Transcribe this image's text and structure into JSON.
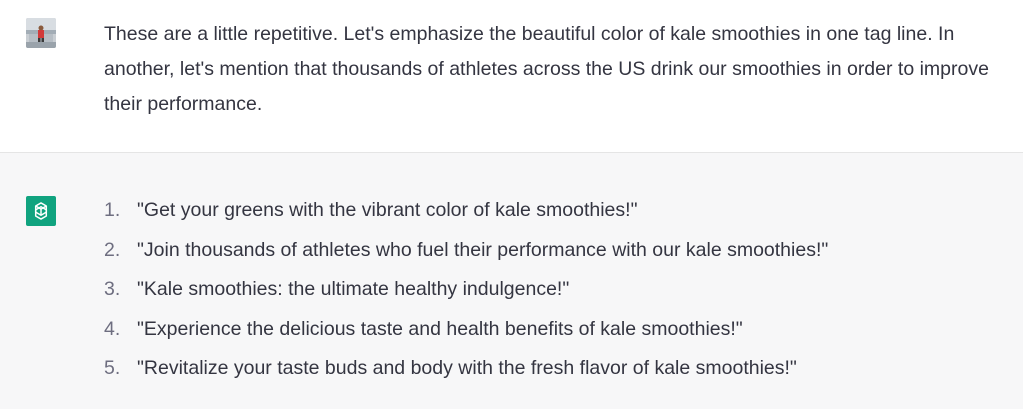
{
  "conversation": {
    "user_message": "These are a little repetitive. Let's emphasize the beautiful color of kale smoothies in one tag line. In another, let's mention that thousands of athletes across the US drink our smoothies in order to improve their performance.",
    "assistant_reply": {
      "items": [
        {
          "number": "1.",
          "text": "\"Get your greens with the vibrant color of kale smoothies!\""
        },
        {
          "number": "2.",
          "text": "\"Join thousands of athletes who fuel their performance with our kale smoothies!\""
        },
        {
          "number": "3.",
          "text": "\"Kale smoothies: the ultimate healthy indulgence!\""
        },
        {
          "number": "4.",
          "text": "\"Experience the delicious taste and health benefits of kale smoothies!\""
        },
        {
          "number": "5.",
          "text": "\"Revitalize your taste buds and body with the fresh flavor of kale smoothies!\""
        }
      ]
    }
  },
  "icons": {
    "user_avatar": "user-avatar-photo",
    "assistant_avatar": "openai-logo-icon"
  },
  "colors": {
    "assistant_bg": "#f7f7f8",
    "assistant_avatar_bg": "#10a37f",
    "text": "#343541",
    "list_number": "#6e6e80"
  }
}
